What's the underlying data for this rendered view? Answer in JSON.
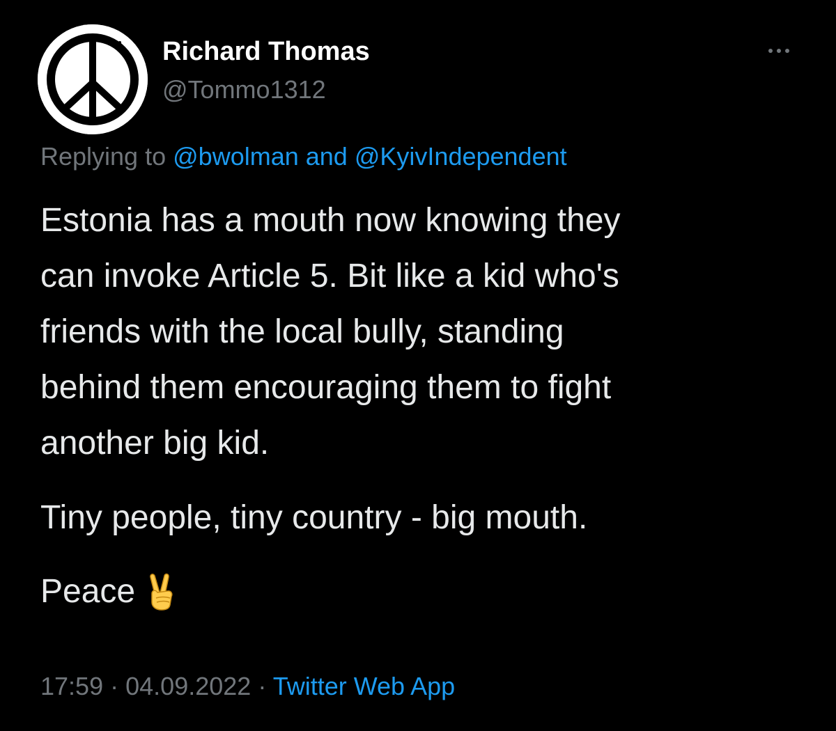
{
  "author": {
    "display_name": "Richard Thomas",
    "handle": "@Tommo1312",
    "avatar_icon": "peace-sign-icon"
  },
  "more_icon": "more-options-icon",
  "reply": {
    "prefix": "Replying to",
    "mention1": "@bwolman",
    "conjunction": "and",
    "mention2": "@KyivIndependent"
  },
  "tweet": {
    "lines": [
      "Estonia has a mouth now knowing they",
      "can invoke Article 5. Bit like a kid who's",
      "friends with the local bully, standing",
      "behind them encouraging them to fight",
      "another big kid."
    ],
    "paragraph2": "Tiny people, tiny country - big mouth.",
    "paragraph3": "Peace",
    "emoji_icon": "victory-hand-emoji-icon"
  },
  "meta": {
    "time": "17:59",
    "separator": "·",
    "date": "04.09.2022",
    "source": "Twitter Web App"
  },
  "colors": {
    "background": "#000000",
    "text": "#e7e9ea",
    "muted": "#71767b",
    "link": "#1d9bf0"
  }
}
